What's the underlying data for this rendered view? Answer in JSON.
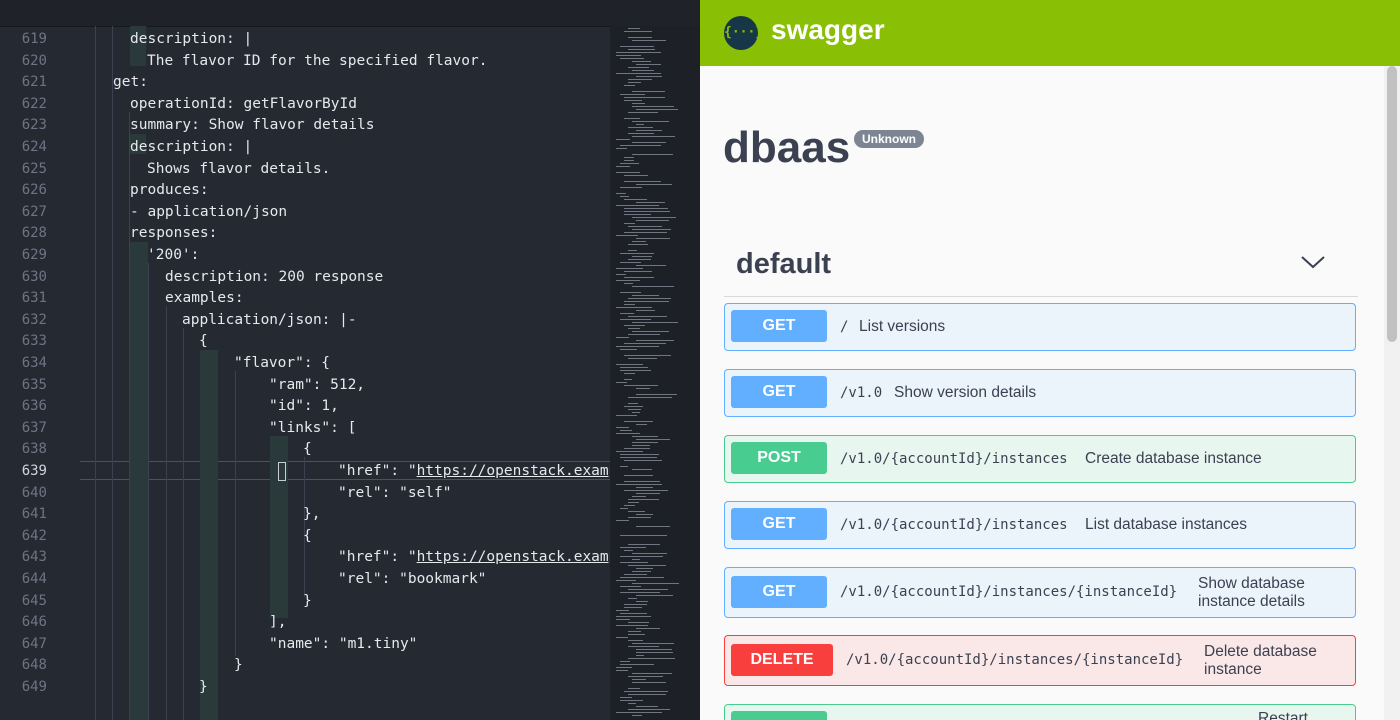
{
  "editor": {
    "active_line": "639",
    "lines": [
      {
        "num": "619",
        "text": "description: |"
      },
      {
        "num": "620",
        "text": "The flavor ID for the specified flavor."
      },
      {
        "num": "621",
        "text": "get:"
      },
      {
        "num": "622",
        "text": "operationId: getFlavorById"
      },
      {
        "num": "623",
        "text": "summary: Show flavor details"
      },
      {
        "num": "624",
        "text": "description: |"
      },
      {
        "num": "625",
        "text": "Shows flavor details."
      },
      {
        "num": "626",
        "text": "produces:"
      },
      {
        "num": "627",
        "text": "- application/json"
      },
      {
        "num": "628",
        "text": "responses:"
      },
      {
        "num": "629",
        "text": "'200':"
      },
      {
        "num": "630",
        "text": "description: 200 response"
      },
      {
        "num": "631",
        "text": "examples:"
      },
      {
        "num": "632",
        "text": "application/json: |-"
      },
      {
        "num": "633",
        "text": "{"
      },
      {
        "num": "634",
        "text": "\"flavor\": {"
      },
      {
        "num": "635",
        "text": "\"ram\": 512,"
      },
      {
        "num": "636",
        "text": "\"id\": 1,"
      },
      {
        "num": "637",
        "text": "\"links\": ["
      },
      {
        "num": "638",
        "text": "{"
      },
      {
        "num": "639",
        "text": "\"href\": \"",
        "url": "https://openstack.examp"
      },
      {
        "num": "640",
        "text": "\"rel\": \"self\""
      },
      {
        "num": "641",
        "text": "},"
      },
      {
        "num": "642",
        "text": "{"
      },
      {
        "num": "643",
        "text": "\"href\": \"",
        "url": "https://openstack.examp"
      },
      {
        "num": "644",
        "text": "\"rel\": \"bookmark\""
      },
      {
        "num": "645",
        "text": "}"
      },
      {
        "num": "646",
        "text": "],"
      },
      {
        "num": "647",
        "text": "\"name\": \"m1.tiny\""
      },
      {
        "num": "648",
        "text": "}"
      },
      {
        "num": "649",
        "text": "}"
      }
    ]
  },
  "swagger": {
    "brand": "swagger",
    "logo_glyph": "{···}",
    "title": "dbaas",
    "version_badge": "Unknown",
    "tag": "default",
    "colors": {
      "header": "#89bf04",
      "get": "#61affe",
      "post": "#49cc90",
      "delete": "#f93e3e"
    },
    "operations": [
      {
        "method": "GET",
        "path": "/",
        "summary": "List versions"
      },
      {
        "method": "GET",
        "path": "/v1.0",
        "summary": "Show version details"
      },
      {
        "method": "POST",
        "path": "/v1.0/{accountId}/instances",
        "summary": "Create database instance"
      },
      {
        "method": "GET",
        "path": "/v1.0/{accountId}/instances",
        "summary": "List database instances"
      },
      {
        "method": "GET",
        "path": "/v1.0/{accountId}/instances/{instanceId}",
        "summary": "Show database instance details"
      },
      {
        "method": "DELETE",
        "path": "/v1.0/{accountId}/instances/{instanceId}",
        "summary": "Delete database instance"
      },
      {
        "method": "POST",
        "path": "",
        "summary": "Restart"
      }
    ]
  }
}
